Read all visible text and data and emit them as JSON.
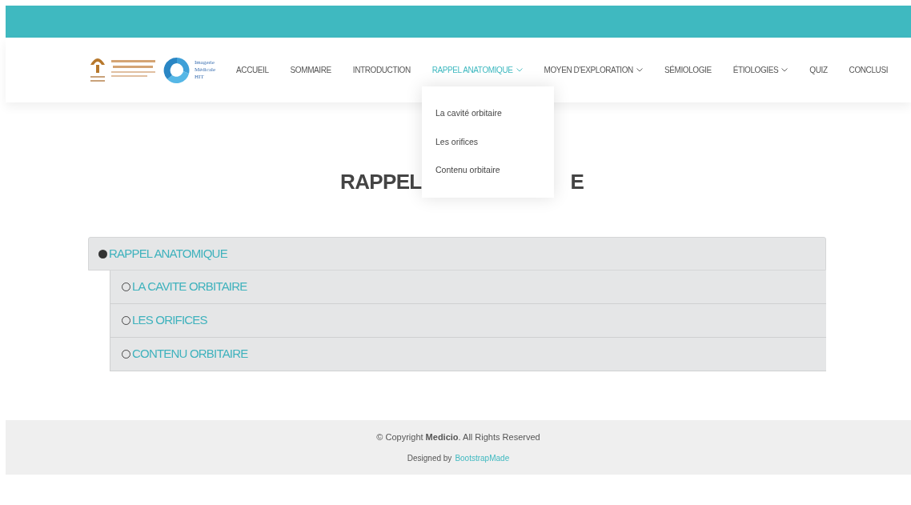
{
  "logo": {
    "lines": [
      "Imagerie",
      "Médicale",
      "HIT"
    ]
  },
  "nav": [
    {
      "label": "ACCUEIL",
      "selected": false,
      "dropdown": false
    },
    {
      "label": "SOMMAIRE",
      "selected": false,
      "dropdown": false
    },
    {
      "label": "INTRODUCTION",
      "selected": false,
      "dropdown": false
    },
    {
      "label": "RAPPEL ANATOMIQUE",
      "selected": true,
      "dropdown": true
    },
    {
      "label": "MOYEN D'EXPLORATION",
      "selected": false,
      "dropdown": true
    },
    {
      "label": "SÉMIOLOGIE",
      "selected": false,
      "dropdown": false
    },
    {
      "label": "ÉTIOLOGIES",
      "selected": false,
      "dropdown": true
    },
    {
      "label": "QUIZ",
      "selected": false,
      "dropdown": false
    },
    {
      "label": "CONCLUSI",
      "selected": false,
      "dropdown": false
    }
  ],
  "dropdown_menu": [
    "La cavité orbitaire",
    "Les orifices",
    "Contenu orbitaire"
  ],
  "page_title": {
    "left": "RAPPEL",
    "right": "E"
  },
  "outline": {
    "label": "RAPPEL ANATOMIQUE",
    "children": [
      {
        "label": "LA CAVITE ORBITAIRE"
      },
      {
        "label": "LES ORIFICES"
      },
      {
        "label": "CONTENU ORBITAIRE"
      }
    ]
  },
  "footer": {
    "copyright": "© Copyright **Medicio**. All Rights Reserved",
    "designed_by": "Designed by",
    "designer_link": "BootstrapMade"
  }
}
